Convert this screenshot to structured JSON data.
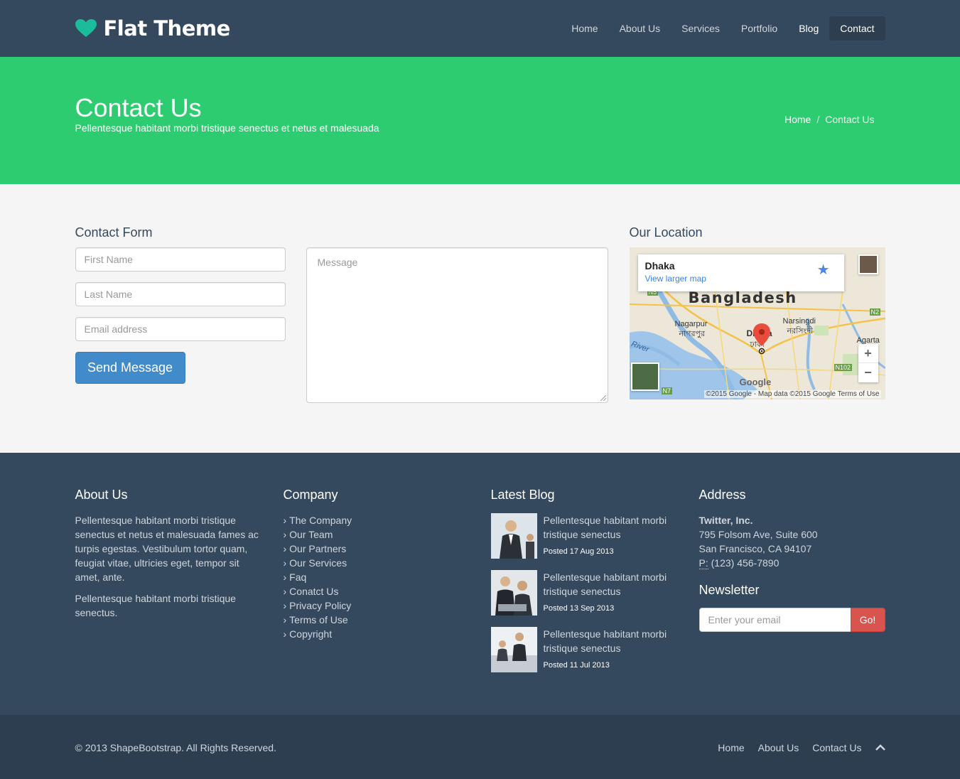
{
  "header": {
    "brand": "Flat Theme",
    "nav": [
      "Home",
      "About Us",
      "Services",
      "Portfolio",
      "Blog",
      "Contact"
    ],
    "active": "Contact"
  },
  "title_band": {
    "title": "Contact Us",
    "subtitle": "Pellentesque habitant morbi tristique senectus et netus et malesuada",
    "breadcrumb": {
      "home": "Home",
      "separator": "/",
      "current": "Contact Us"
    }
  },
  "contact": {
    "form_title": "Contact Form",
    "first_name_placeholder": "First Name",
    "last_name_placeholder": "Last Name",
    "email_placeholder": "Email address",
    "message_placeholder": "Message",
    "send_label": "Send Message"
  },
  "location": {
    "title": "Our Location",
    "city": "Dhaka",
    "view_link": "View larger map",
    "country_label": "Bangladesh",
    "place_labels": [
      "Nagarpur",
      "নাগরপুর",
      "Narsingdi",
      "নরসিংদী",
      "Dhaka",
      "ঢাকা",
      "River",
      "Agarta",
      "N5",
      "N2",
      "N102",
      "N7"
    ],
    "attribution": "©2015 Google - Map data ©2015 Google    Terms of Use",
    "google_logo": "Google",
    "zoom_in": "+",
    "zoom_out": "−"
  },
  "footer_widgets": {
    "about": {
      "title": "About Us",
      "text1": "Pellentesque habitant morbi tristique senectus et netus et malesuada fames ac turpis egestas. Vestibulum tortor quam, feugiat vitae, ultricies eget, tempor sit amet, ante.",
      "text2": "Pellentesque habitant morbi tristique senectus."
    },
    "company": {
      "title": "Company",
      "links": [
        "The Company",
        "Our Team",
        "Our Partners",
        "Our Services",
        "Faq",
        "Conatct Us",
        "Privacy Policy",
        "Terms of Use",
        "Copyright"
      ]
    },
    "blog": {
      "title": "Latest Blog",
      "posts": [
        {
          "title": "Pellentesque habitant morbi tristique senectus",
          "date": "Posted 17 Aug 2013"
        },
        {
          "title": "Pellentesque habitant morbi tristique senectus",
          "date": "Posted 13 Sep 2013"
        },
        {
          "title": "Pellentesque habitant morbi tristique senectus",
          "date": "Posted 11 Jul 2013"
        }
      ]
    },
    "address": {
      "title": "Address",
      "company": "Twitter, Inc.",
      "street": "795 Folsom Ave, Suite 600",
      "city": "San Francisco, CA 94107",
      "phone_label": "P:",
      "phone": "(123) 456-7890",
      "newsletter_title": "Newsletter",
      "newsletter_placeholder": "Enter your email",
      "newsletter_button": "Go!"
    }
  },
  "footer": {
    "copyright": "© 2013 ShapeBootstrap. All Rights Reserved.",
    "links": [
      "Home",
      "About Us",
      "Contact Us"
    ]
  },
  "colors": {
    "header_bg": "#34495e",
    "accent_green": "#2ecc71",
    "brand_heart": "#1abc9c",
    "button_blue": "#428bca",
    "go_red": "#d9534f",
    "footer_bg": "#2c3e50"
  },
  "icons": {
    "brand": "heart-icon",
    "map_marker": "map-pin-icon",
    "save_star": "star-icon",
    "scroll_top": "chevron-up-icon"
  }
}
